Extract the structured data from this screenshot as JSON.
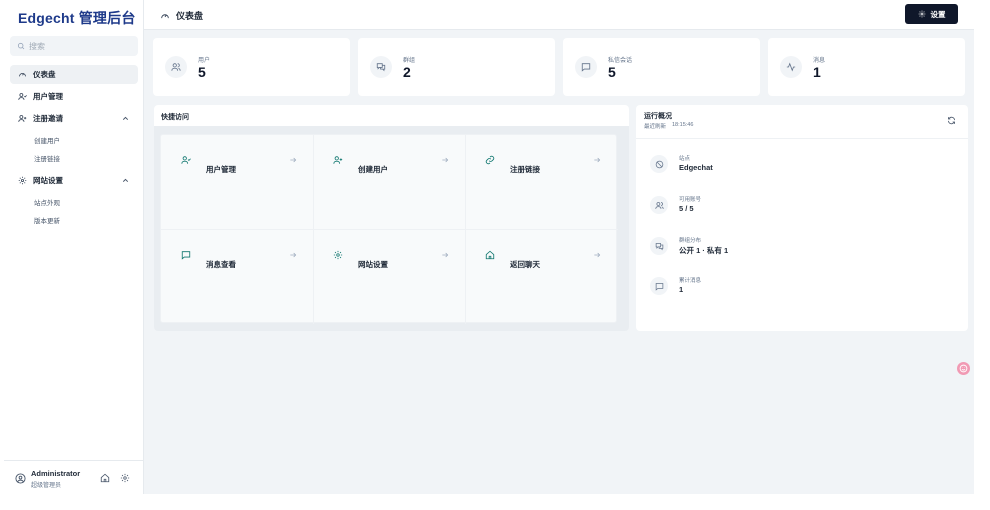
{
  "app": {
    "brand": "Edgecht 管理后台"
  },
  "search": {
    "placeholder": "搜索"
  },
  "sidebar": {
    "items": [
      {
        "label": "仪表盘",
        "icon": "gauge-icon"
      },
      {
        "label": "用户管理",
        "icon": "users-icon"
      },
      {
        "label": "注册邀请",
        "icon": "user-plus-icon"
      },
      {
        "label": "网站设置",
        "icon": "gear-icon"
      }
    ],
    "invite_subitems": [
      "创建用户",
      "注册链接"
    ],
    "site_subitems": [
      "站点外观",
      "版本更新"
    ]
  },
  "footer": {
    "name": "Administrator",
    "role": "超级管理员"
  },
  "header": {
    "title": "仪表盘",
    "settings_label": "设置"
  },
  "stats": [
    {
      "label": "用户",
      "value": "5",
      "icon": "users-icon"
    },
    {
      "label": "群组",
      "value": "2",
      "icon": "chat-group-icon"
    },
    {
      "label": "私信会话",
      "value": "5",
      "icon": "message-square-icon"
    },
    {
      "label": "消息",
      "value": "1",
      "icon": "activity-icon"
    }
  ],
  "quick_access": {
    "title": "快捷访问",
    "tiles": [
      {
        "label": "用户管理",
        "icon": "users-icon"
      },
      {
        "label": "创建用户",
        "icon": "user-plus-icon"
      },
      {
        "label": "注册链接",
        "icon": "link-icon"
      },
      {
        "label": "消息查看",
        "icon": "message-square-icon"
      },
      {
        "label": "网站设置",
        "icon": "gear-icon"
      },
      {
        "label": "返回聊天",
        "icon": "home-icon"
      }
    ]
  },
  "overview": {
    "title": "运行概况",
    "refreshed_label": "最近刷新",
    "refreshed_time": "18:15:46",
    "rows": [
      {
        "label": "站点",
        "value": "Edgechat",
        "icon": "globe-icon"
      },
      {
        "label": "可用账号",
        "value": "5 / 5",
        "icon": "users-icon"
      },
      {
        "label": "群组分布",
        "value": "公开 1 · 私有 1",
        "icon": "chat-group-icon"
      },
      {
        "label": "累计消息",
        "value": "1",
        "icon": "message-square-icon"
      }
    ]
  },
  "colors": {
    "brand": "#1e3a8a",
    "accent_dark": "#0f172a",
    "icon_teal": "#0f766e",
    "bubble": "#f19ab4"
  }
}
